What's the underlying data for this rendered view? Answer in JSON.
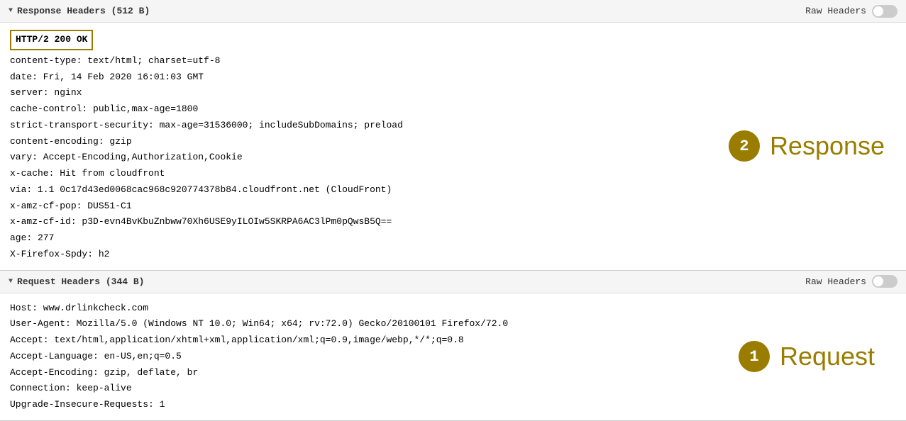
{
  "response_panel": {
    "title": "Response Headers (512 B)",
    "raw_headers_label": "Raw Headers",
    "status_badge": "HTTP/2 200 OK",
    "lines": [
      "content-type: text/html; charset=utf-8",
      "date: Fri, 14 Feb 2020 16:01:03 GMT",
      "server: nginx",
      "cache-control: public,max-age=1800",
      "strict-transport-security: max-age=31536000; includeSubDomains; preload",
      "content-encoding: gzip",
      "vary: Accept-Encoding,Authorization,Cookie",
      "x-cache: Hit from cloudfront",
      "via: 1.1 0c17d43ed0068cac968c920774378b84.cloudfront.net (CloudFront)",
      "x-amz-cf-pop: DUS51-C1",
      "x-amz-cf-id: p3D-evn4BvKbuZnbww70Xh6USE9yILOIw5SKRPA6AC3lPm0pQwsB5Q==",
      "age: 277",
      "X-Firefox-Spdy: h2"
    ],
    "side_number": "2",
    "side_text": "Response"
  },
  "request_panel": {
    "title": "Request Headers (344 B)",
    "raw_headers_label": "Raw Headers",
    "lines": [
      "Host: www.drlinkcheck.com",
      "User-Agent: Mozilla/5.0 (Windows NT 10.0; Win64; x64; rv:72.0) Gecko/20100101 Firefox/72.0",
      "Accept: text/html,application/xhtml+xml,application/xml;q=0.9,image/webp,*/*;q=0.8",
      "Accept-Language: en-US,en;q=0.5",
      "Accept-Encoding: gzip, deflate, br",
      "Connection: keep-alive",
      "Upgrade-Insecure-Requests: 1"
    ],
    "side_number": "1",
    "side_text": "Request"
  }
}
